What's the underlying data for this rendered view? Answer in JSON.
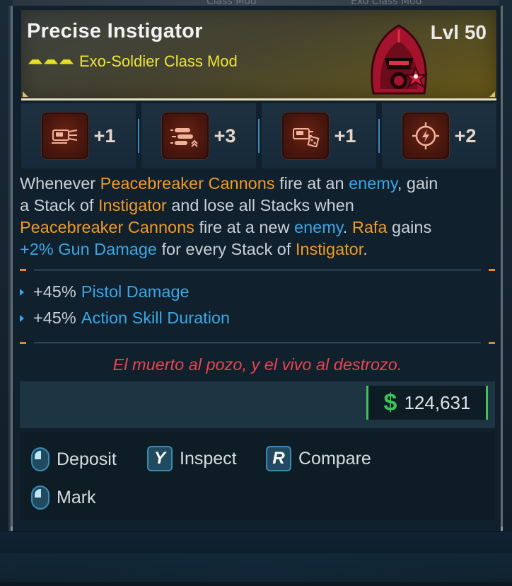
{
  "item": {
    "name": "Precise Instigator",
    "type": "Exo-Soldier Class Mod",
    "level": "Lvl 50",
    "rarity_color": "#e7e021"
  },
  "stats": [
    {
      "icon": "gun-heat-icon",
      "value": "+1"
    },
    {
      "icon": "bullets-speed-icon",
      "value": "+3"
    },
    {
      "icon": "gun-crate-icon",
      "value": "+1"
    },
    {
      "icon": "crosshair-bolt-icon",
      "value": "+2"
    }
  ],
  "description": {
    "l1_a": "Whenever ",
    "l1_b": "Peacebreaker Cannons",
    "l1_c": " fire at an ",
    "l1_d": "enemy",
    "l1_e": ", gain",
    "l2_a": "a Stack of ",
    "l2_b": "Instigator",
    "l2_c": " and lose all Stacks when",
    "l3_a": "Peacebreaker Cannons",
    "l3_b": " fire at a new ",
    "l3_c": "enemy",
    "l3_d": ". ",
    "l3_e": "Rafa",
    "l3_f": " gains",
    "l4_a": "+2% Gun Damage",
    "l4_b": " for every Stack of ",
    "l4_c": "Instigator",
    "l4_d": "."
  },
  "bonuses": [
    {
      "pct": "+45%",
      "label": "Pistol Damage"
    },
    {
      "pct": "+45%",
      "label": "Action Skill Duration"
    }
  ],
  "flavor_text": "El muerto al pozo, y el vivo al destrozo.",
  "price": {
    "symbol": "$",
    "value": "124,631"
  },
  "actions": {
    "deposit": "Deposit",
    "inspect_key": "Y",
    "inspect": "Inspect",
    "compare_key": "R",
    "compare": "Compare",
    "mark": "Mark"
  },
  "colors": {
    "orange_highlight": "#f09a2a",
    "blue_highlight": "#3aa7e6",
    "flavor": "#e84652",
    "money": "#3fc25a",
    "header_rarity": "#e7e021"
  },
  "background_ghost": {
    "left": "Class Mod",
    "right": "Exo Class Mod"
  }
}
